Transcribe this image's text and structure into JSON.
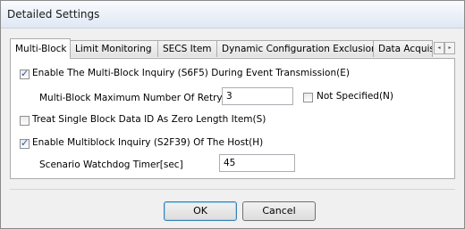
{
  "window": {
    "title": "Detailed Settings"
  },
  "tabs": [
    {
      "label": "Multi-Block"
    },
    {
      "label": "Limit Monitoring"
    },
    {
      "label": "SECS Item"
    },
    {
      "label": "Dynamic Configuration Exclusion"
    },
    {
      "label": "Data Acquisi"
    }
  ],
  "tab_scroll": {
    "left": "◂",
    "right": "▸"
  },
  "multi_block": {
    "enable_s6f5": {
      "label": "Enable The Multi-Block Inquiry (S6F5) During Event Transmission(E)",
      "checked": true
    },
    "max_retry": {
      "label": "Multi-Block Maximum Number Of Retry",
      "value": "3"
    },
    "not_specified": {
      "label": "Not Specified(N)",
      "checked": false
    },
    "single_block_zero": {
      "label": "Treat Single Block Data ID As Zero Length Item(S)",
      "checked": false
    },
    "enable_s2f39": {
      "label": "Enable Multiblock Inquiry (S2F39) Of The Host(H)",
      "checked": true
    },
    "watchdog": {
      "label": "Scenario Watchdog Timer[sec]",
      "value": "45"
    }
  },
  "buttons": {
    "ok": "OK",
    "cancel": "Cancel"
  },
  "check_glyph": "✓"
}
